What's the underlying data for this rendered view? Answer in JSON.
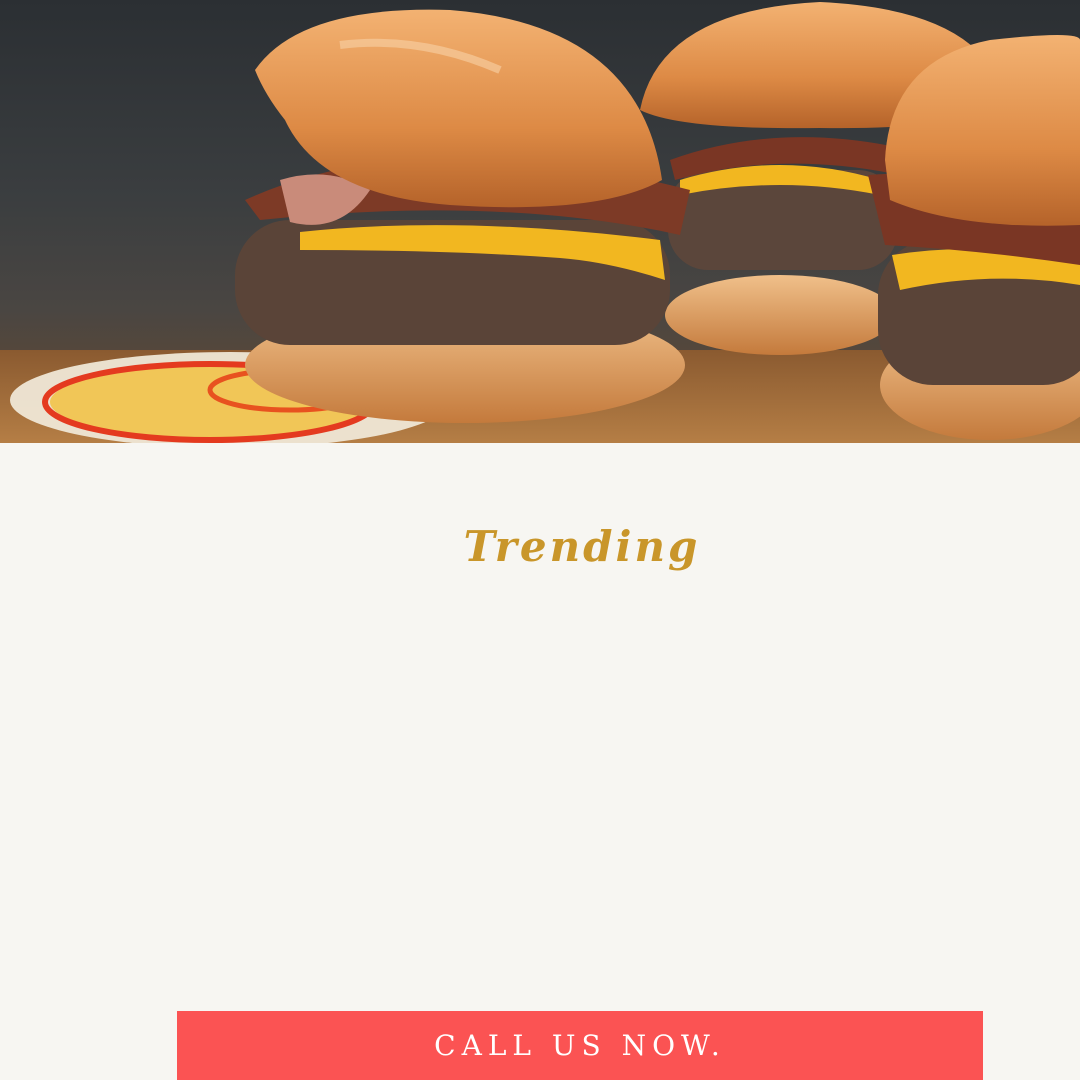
{
  "hero": {
    "image_subject": "burger sliders photo",
    "colors": {
      "bun": "#e39a52",
      "patty": "#5a4438",
      "cheese": "#f2b720",
      "board": "#a8723d"
    }
  },
  "main": {
    "heading": "Trending",
    "heading_color": "#c9962a"
  },
  "cta": {
    "label": "CALL US NOW.",
    "color": "#fb5353"
  },
  "page": {
    "background": "#f7f6f2"
  }
}
